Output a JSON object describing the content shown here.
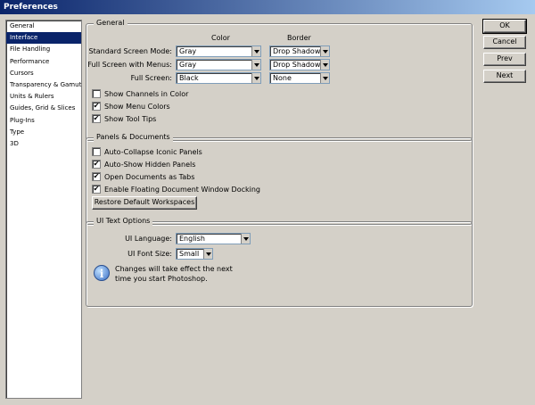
{
  "window": {
    "title": "Preferences"
  },
  "sidebar": {
    "items": [
      {
        "label": "General",
        "selected": false
      },
      {
        "label": "Interface",
        "selected": true
      },
      {
        "label": "File Handling",
        "selected": false
      },
      {
        "label": "Performance",
        "selected": false
      },
      {
        "label": "Cursors",
        "selected": false
      },
      {
        "label": "Transparency & Gamut",
        "selected": false
      },
      {
        "label": "Units & Rulers",
        "selected": false
      },
      {
        "label": "Guides, Grid & Slices",
        "selected": false
      },
      {
        "label": "Plug-Ins",
        "selected": false
      },
      {
        "label": "Type",
        "selected": false
      },
      {
        "label": "3D",
        "selected": false
      }
    ]
  },
  "general": {
    "title": "General",
    "col_color": "Color",
    "col_border": "Border",
    "rows": [
      {
        "label": "Standard Screen Mode:",
        "color": "Gray",
        "border": "Drop Shadow"
      },
      {
        "label": "Full Screen with Menus:",
        "color": "Gray",
        "border": "Drop Shadow"
      },
      {
        "label": "Full Screen:",
        "color": "Black",
        "border": "None"
      }
    ],
    "checks": [
      {
        "label": "Show Channels in Color",
        "checked": false
      },
      {
        "label": "Show Menu Colors",
        "checked": true
      },
      {
        "label": "Show Tool Tips",
        "checked": true
      }
    ]
  },
  "panels": {
    "title": "Panels & Documents",
    "checks": [
      {
        "label": "Auto-Collapse Iconic Panels",
        "checked": false
      },
      {
        "label": "Auto-Show Hidden Panels",
        "checked": true
      },
      {
        "label": "Open Documents as Tabs",
        "checked": true
      },
      {
        "label": "Enable Floating Document Window Docking",
        "checked": true
      }
    ],
    "restore_button": "Restore Default Workspaces"
  },
  "ui_text": {
    "title": "UI Text Options",
    "language_label": "UI Language:",
    "language_value": "English",
    "font_size_label": "UI Font Size:",
    "font_size_value": "Small",
    "info_line1": "Changes will take effect the next",
    "info_line2": "time you start Photoshop."
  },
  "buttons": {
    "ok": "OK",
    "cancel": "Cancel",
    "prev": "Prev",
    "next": "Next"
  },
  "check_mark": "✔"
}
